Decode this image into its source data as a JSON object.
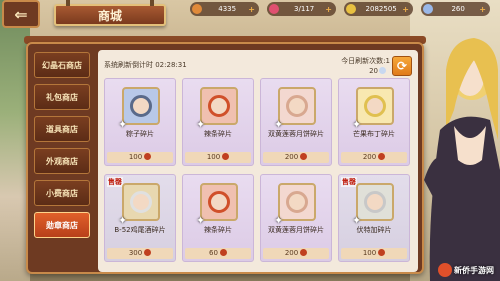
{
  "header": {
    "title": "商城",
    "currencies": [
      {
        "icon": "gold-coin-icon",
        "value": "4335",
        "color": "#e08a3a"
      },
      {
        "icon": "heart-icon",
        "value": "3/117",
        "color": "#e05070"
      },
      {
        "icon": "silver-coin-icon",
        "value": "2082505",
        "color": "#e8c040"
      },
      {
        "icon": "diamond-icon",
        "value": "260",
        "color": "#9ab8e8"
      }
    ]
  },
  "sidebar": {
    "items": [
      {
        "label": "幻晶石商店",
        "active": false
      },
      {
        "label": "礼包商店",
        "active": false
      },
      {
        "label": "道具商店",
        "active": false
      },
      {
        "label": "外观商店",
        "active": false
      },
      {
        "label": "小费商店",
        "active": false
      },
      {
        "label": "勋章商店",
        "active": true
      }
    ]
  },
  "shop": {
    "refresh_timer": "系统刷新倒计时 02:28:31",
    "refresh_count": "今日刷新次数:1",
    "refresh_cost": "20",
    "items": [
      {
        "name": "粽子碎片",
        "price": "100",
        "sold": "",
        "hair": "#5a6a8a"
      },
      {
        "name": "辣条碎片",
        "price": "100",
        "sold": "",
        "hair": "#d0502a"
      },
      {
        "name": "双黄莲蓉月饼碎片",
        "price": "200",
        "sold": "",
        "hair": "#d8a890"
      },
      {
        "name": "芒果布丁碎片",
        "price": "200",
        "sold": "",
        "hair": "#e0c050"
      },
      {
        "name": "B-52鸡尾酒碎片",
        "price": "300",
        "sold": "售罄",
        "hair": "#e0e0e0"
      },
      {
        "name": "辣条碎片",
        "price": "60",
        "sold": "",
        "hair": "#d0502a"
      },
      {
        "name": "双黄莲蓉月饼碎片",
        "price": "200",
        "sold": "",
        "hair": "#d8a890"
      },
      {
        "name": "伏特加碎片",
        "price": "100",
        "sold": "售罄",
        "hair": "#c8c8c8"
      }
    ]
  },
  "watermark": "新侨手游网"
}
